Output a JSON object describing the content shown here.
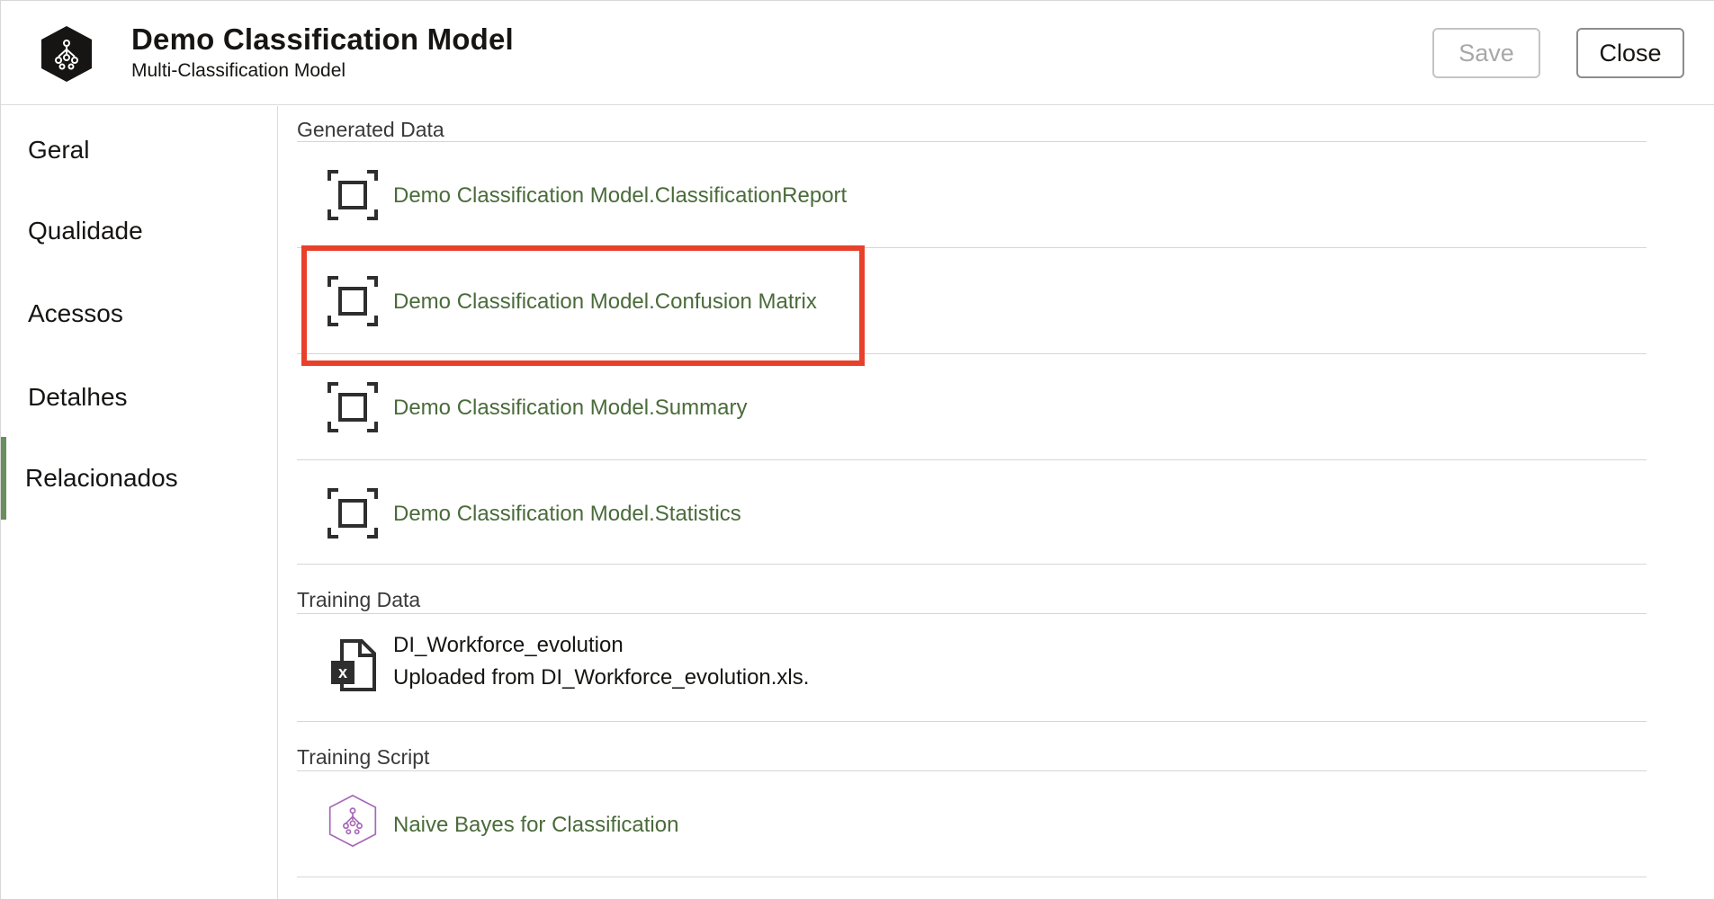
{
  "header": {
    "title": "Demo Classification Model",
    "subtitle": "Multi-Classification Model",
    "save_label": "Save",
    "close_label": "Close",
    "icon": "model-hexagon-icon"
  },
  "sidebar": {
    "items": [
      {
        "label": "Geral"
      },
      {
        "label": "Qualidade"
      },
      {
        "label": "Acessos"
      },
      {
        "label": "Detalhes"
      },
      {
        "label": "Relacionados",
        "active": true
      }
    ]
  },
  "sections": {
    "generated": {
      "title": "Generated Data",
      "items": [
        {
          "label": "Demo Classification Model.ClassificationReport",
          "icon": "dataset-frame-icon"
        },
        {
          "label": "Demo Classification Model.Confusion Matrix",
          "icon": "dataset-frame-icon",
          "highlighted": true
        },
        {
          "label": "Demo Classification Model.Summary",
          "icon": "dataset-frame-icon"
        },
        {
          "label": "Demo Classification Model.Statistics",
          "icon": "dataset-frame-icon"
        }
      ]
    },
    "training_data": {
      "title": "Training Data",
      "items": [
        {
          "label": "DI_Workforce_evolution",
          "detail": "Uploaded from DI_Workforce_evolution.xls.",
          "icon": "excel-file-icon"
        }
      ]
    },
    "training_script": {
      "title": "Training Script",
      "items": [
        {
          "label": "Naive Bayes for Classification",
          "icon": "script-hexagon-icon"
        }
      ]
    }
  },
  "colors": {
    "link": "#4a6b3a",
    "active_bar": "#6b8e5e",
    "highlight": "#e8402a",
    "script_icon": "#a768b8"
  }
}
